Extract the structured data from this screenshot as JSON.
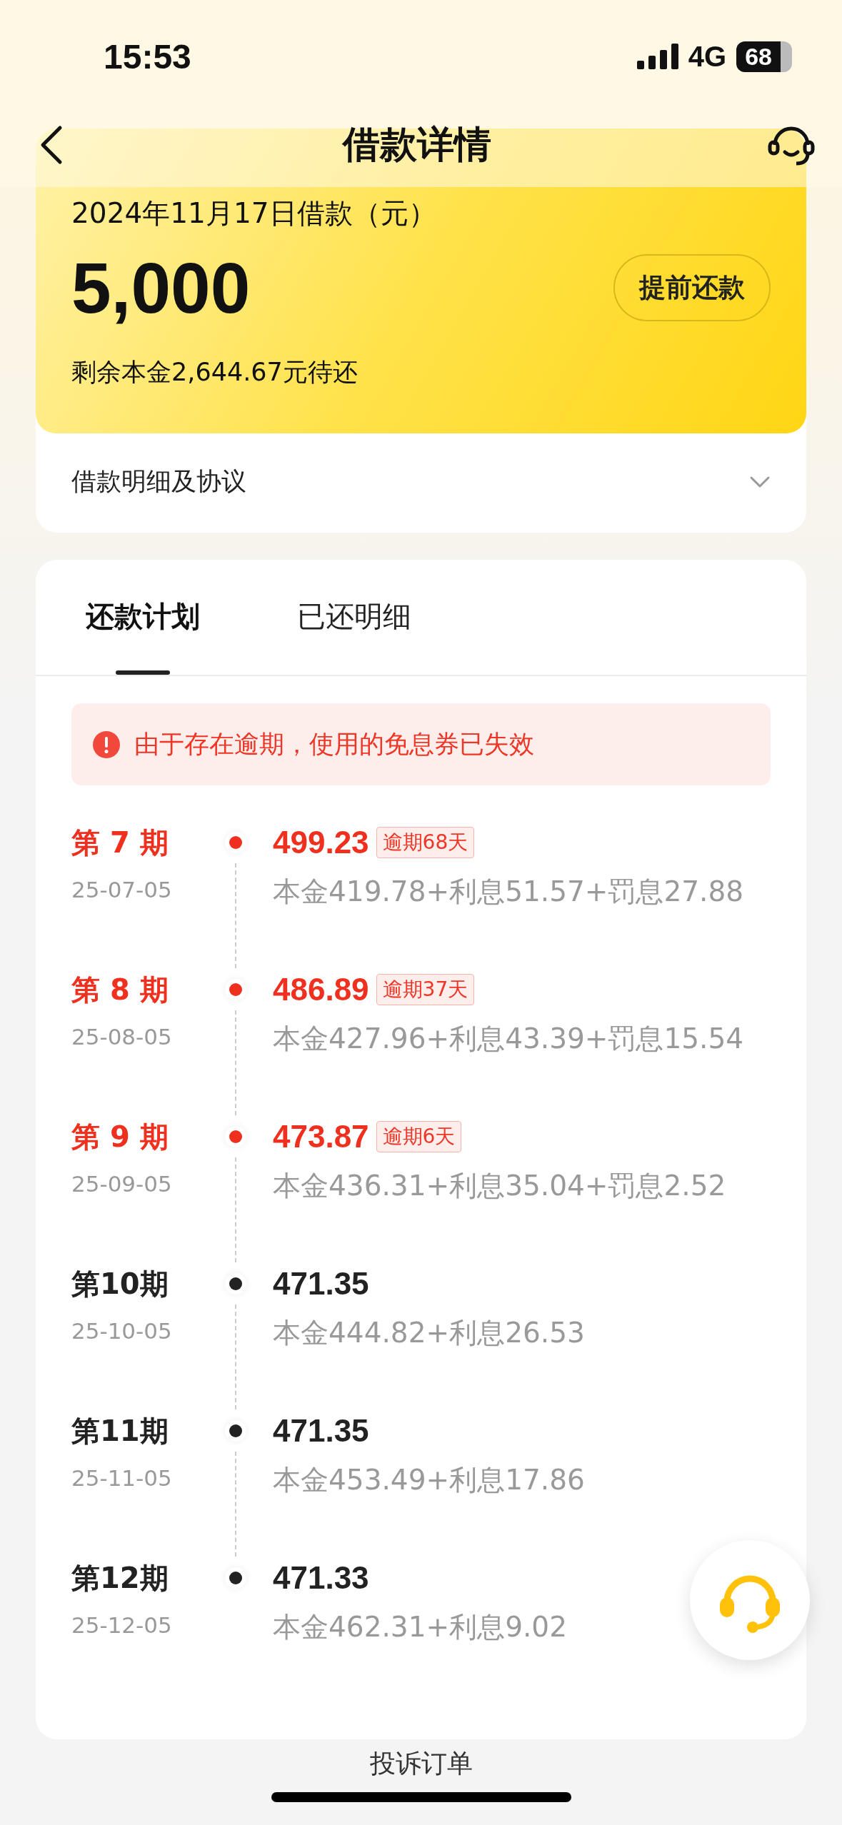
{
  "status_bar": {
    "time": "15:53",
    "network": "4G",
    "battery": "68"
  },
  "nav": {
    "title": "借款详情"
  },
  "loan": {
    "date_label": "2024年11月17日借款（元）",
    "amount": "5,000",
    "prepay_button": "提前还款",
    "remaining": "剩余本金2,644.67元待还"
  },
  "details_row": {
    "label": "借款明细及协议"
  },
  "tabs": [
    {
      "label": "还款计划",
      "selected": true
    },
    {
      "label": "已还明细",
      "selected": false
    }
  ],
  "alert": {
    "text": "由于存在逾期，使用的免息券已失效"
  },
  "installments": [
    {
      "period": "第 7 期",
      "date": "25-07-05",
      "amount": "499.23",
      "overdue": true,
      "tag": "逾期68天",
      "breakdown": "本金419.78+利息51.57+罚息27.88"
    },
    {
      "period": "第 8 期",
      "date": "25-08-05",
      "amount": "486.89",
      "overdue": true,
      "tag": "逾期37天",
      "breakdown": "本金427.96+利息43.39+罚息15.54"
    },
    {
      "period": "第 9 期",
      "date": "25-09-05",
      "amount": "473.87",
      "overdue": true,
      "tag": "逾期6天",
      "breakdown": "本金436.31+利息35.04+罚息2.52"
    },
    {
      "period": "第10期",
      "date": "25-10-05",
      "amount": "471.35",
      "overdue": false,
      "breakdown": "本金444.82+利息26.53"
    },
    {
      "period": "第11期",
      "date": "25-11-05",
      "amount": "471.35",
      "overdue": false,
      "breakdown": "本金453.49+利息17.86"
    },
    {
      "period": "第12期",
      "date": "25-12-05",
      "amount": "471.33",
      "overdue": false,
      "breakdown": "本金462.31+利息9.02"
    }
  ],
  "footer": {
    "link": "投诉订单"
  }
}
